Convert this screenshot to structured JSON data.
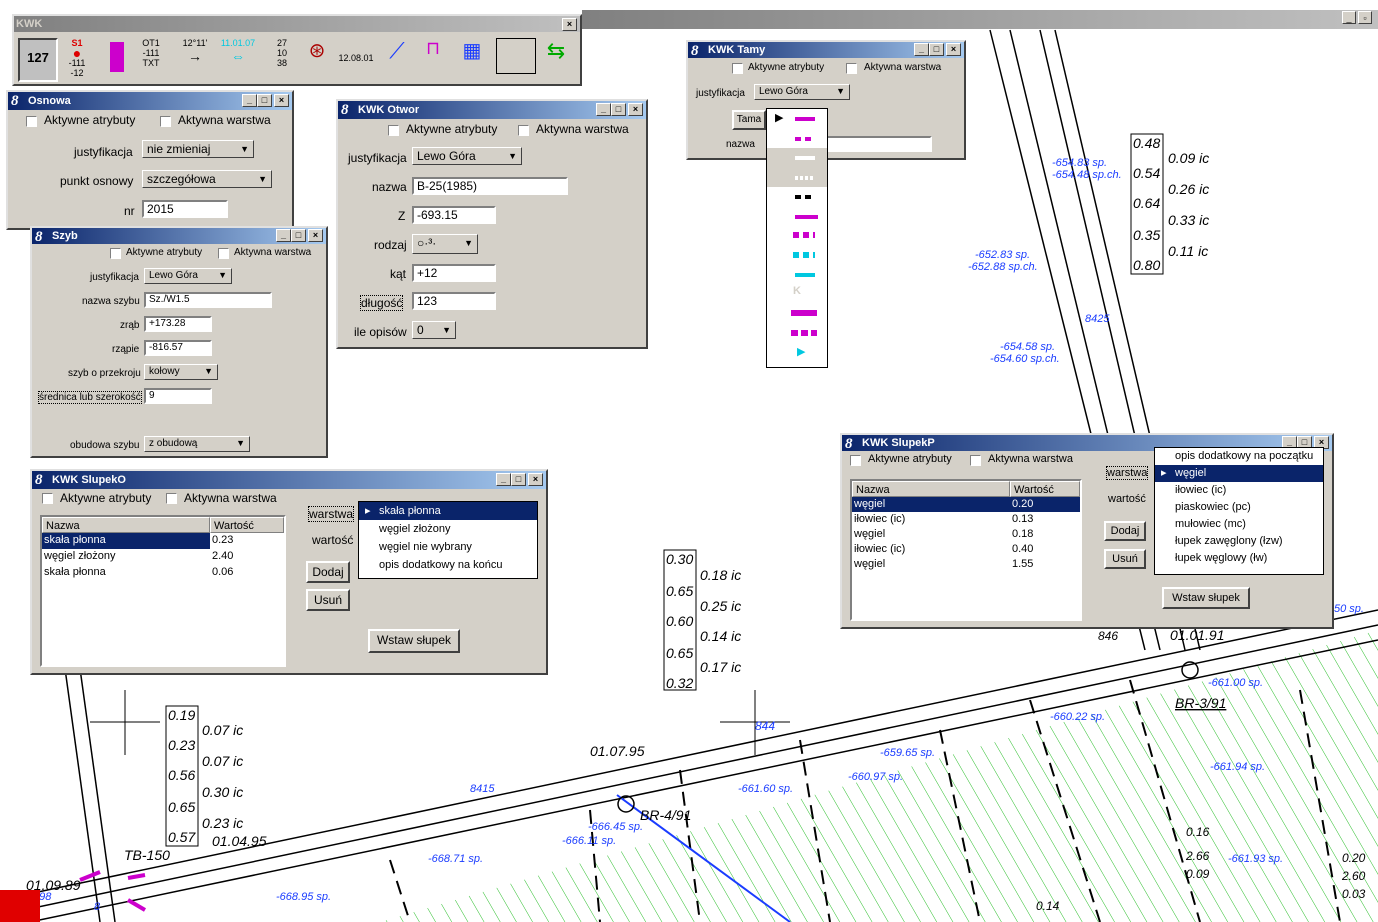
{
  "toolbar": {
    "title": "KWK",
    "close": "×",
    "tools": [
      "127",
      "S1",
      "-111",
      "-12",
      "OT1",
      "-111",
      "TXT",
      "12°11'",
      "11.01.07",
      "27",
      "10",
      "38",
      "12.08.01"
    ]
  },
  "main_window": {
    "restore": "_",
    "max": "▫"
  },
  "osnowa": {
    "title": "Osnowa",
    "aktywne_atrybuty": "Aktywne atrybuty",
    "aktywna_warstwa": "Aktywna warstwa",
    "justyfikacja_label": "justyfikacja",
    "justyfikacja": "nie zmieniaj",
    "punkt_label": "punkt osnowy",
    "punkt": "szczegółowa",
    "nr_label": "nr",
    "nr": "2015"
  },
  "szyb": {
    "title": "Szyb",
    "aktywne_atrybuty": "Aktywne atrybuty",
    "aktywna_warstwa": "Aktywna warstwa",
    "justyfikacja_label": "justyfikacja",
    "justyfikacja": "Lewo Góra",
    "nazwa_label": "nazwa szybu",
    "nazwa": "Sz./W1.5",
    "zrab_label": "zrąb",
    "zrab": "+173.28",
    "rzapie_label": "rząpie",
    "rzapie": "-816.57",
    "przekroj_label": "szyb o przekroju",
    "przekroj": "kołowy",
    "srednica_label": "średnica lub szerokość",
    "srednica": "9",
    "obudowa_label": "obudowa szybu",
    "obudowa": "z obudową"
  },
  "otwor": {
    "title": "KWK Otwor",
    "aktywne_atrybuty": "Aktywne atrybuty",
    "aktywna_warstwa": "Aktywna warstwa",
    "justyfikacja_label": "justyfikacja",
    "justyfikacja": "Lewo Góra",
    "nazwa_label": "nazwa",
    "nazwa": "B-25(1985)",
    "z_label": "Z",
    "z": "-693.15",
    "rodzaj_label": "rodzaj",
    "kat_label": "kąt",
    "kat": "+12",
    "dlugosc_label": "długość",
    "dlugosc": "123",
    "opisow_label": "ile opisów",
    "opisow": "0"
  },
  "tamy": {
    "title": "KWK Tamy",
    "aktywne_atrybuty": "Aktywne atrybuty",
    "aktywna_warstwa": "Aktywna warstwa",
    "justyfikacja_label": "justyfikacja",
    "justyfikacja": "Lewo Góra",
    "tama_label": "Tama",
    "nazwa_label": "nazwa",
    "menu_k": "K"
  },
  "slupek0": {
    "title": "KWK SlupekO",
    "aktywne_atrybuty": "Aktywne atrybuty",
    "aktywna_warstwa": "Aktywna warstwa",
    "col_nazwa": "Nazwa",
    "col_wartosc": "Wartość",
    "rows": [
      {
        "n": "skała płonna",
        "v": "0.23"
      },
      {
        "n": "węgiel złożony",
        "v": "2.40"
      },
      {
        "n": "skała płonna",
        "v": "0.06"
      }
    ],
    "warstwa_label": "warstwa",
    "wartosc_label": "wartość",
    "dodaj": "Dodaj",
    "usun": "Usuń",
    "wstaw": "Wstaw słupek",
    "dropdown": [
      "skała płonna",
      "węgiel złożony",
      "węgiel nie wybrany",
      "opis dodatkowy na końcu"
    ]
  },
  "slupekP": {
    "title": "KWK SlupekP",
    "aktywne_atrybuty": "Aktywne atrybuty",
    "aktywna_warstwa": "Aktywna warstwa",
    "col_nazwa": "Nazwa",
    "col_wartosc": "Wartość",
    "rows": [
      {
        "n": "węgiel",
        "v": "0.20"
      },
      {
        "n": "iłowiec (ic)",
        "v": "0.13"
      },
      {
        "n": "węgiel",
        "v": "0.18"
      },
      {
        "n": "iłowiec (ic)",
        "v": "0.40"
      },
      {
        "n": "węgiel",
        "v": "1.55"
      }
    ],
    "warstwa_label": "warstwa",
    "wartosc_label": "wartość",
    "dodaj": "Dodaj",
    "usun": "Usuń",
    "wstaw": "Wstaw słupek",
    "dropdown": [
      "opis dodatkowy na początku",
      "węgiel",
      "iłowiec (ic)",
      "piaskowiec (pc)",
      "mułowiec (mc)",
      "łupek zawęglony (łzw)",
      "łupek węglowy (łw)"
    ]
  },
  "map": {
    "col1": [
      "0.48",
      "0.54",
      "0.64",
      "0.35",
      "0.80"
    ],
    "col1_ic": [
      "0.09 ic",
      "0.26 ic",
      "0.33 ic",
      "0.11 ic"
    ],
    "col2": [
      "0.30",
      "0.65",
      "0.60",
      "0.65",
      "0.32"
    ],
    "col2_ic": [
      "0.18 ic",
      "0.25 ic",
      "0.14 ic",
      "0.17 ic"
    ],
    "col3": [
      "0.19",
      "0.23",
      "0.56",
      "0.65",
      "0.57"
    ],
    "col3_ic": [
      "0.07 ic",
      "0.07 ic",
      "0.30 ic",
      "0.23 ic"
    ],
    "labels": [
      "-654.83 sp.",
      "-654.48 sp.ch.",
      "-652.83 sp.",
      "-652.88 sp.ch.",
      "8425",
      "-654.58 sp.",
      "-654.60 sp.ch.",
      "-660.22 sp.",
      "-659.65 sp.",
      "-660.97 sp.",
      "-661.94 sp.",
      "-661.60 sp.",
      "-661.00 sp.",
      "BR-3/91",
      "01.01.91",
      "846",
      "8415",
      "01.07.95",
      "844",
      "BR-4/91",
      "-666.45 sp.",
      "-666.11 sp.",
      "-668.71 sp.",
      "TB-150",
      "01.04.95",
      "01.09.89",
      "-668.95 sp.",
      "2.98",
      "8",
      "-661.93 sp.",
      "50 sp.",
      "0.16",
      "2.66",
      "0.09",
      "0.20",
      "2.60",
      "0.03",
      "0.14"
    ]
  }
}
